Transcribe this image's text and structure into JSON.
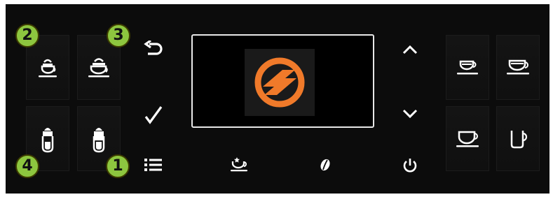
{
  "badges": {
    "b1": "1",
    "b2": "2",
    "b3": "3",
    "b4": "4"
  },
  "colors": {
    "panel": "#0c0c0c",
    "icon": "#ffffff",
    "accent": "#f07a2a",
    "badge": "#8dc63f"
  },
  "icons": {
    "left_top": [
      "cappuccino-small-cup-icon",
      "cappuccino-cup-icon"
    ],
    "left_bottom": [
      "latte-glass-small-icon",
      "latte-glass-icon"
    ],
    "right_top": [
      "espresso-cup-icon",
      "espresso-double-cup-icon"
    ],
    "right_bottom": [
      "coffee-cup-icon",
      "mug-icon"
    ],
    "controls": [
      "back-icon",
      "check-icon",
      "menu-icon",
      "favorite-cup-icon",
      "bean-icon",
      "up-arrow-icon",
      "down-arrow-icon",
      "power-icon"
    ],
    "logo": "brand-logo-icon"
  }
}
